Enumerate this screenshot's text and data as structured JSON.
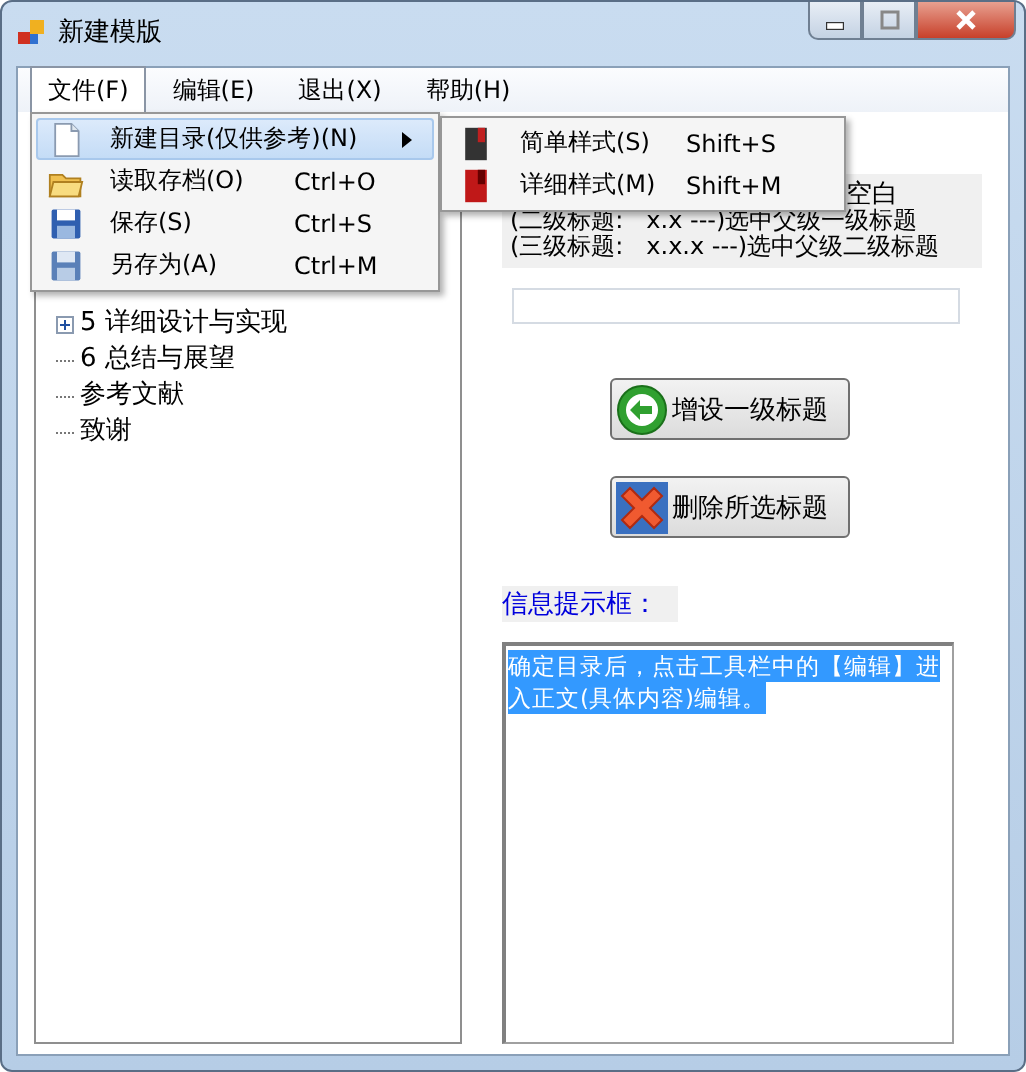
{
  "window": {
    "title": "新建模版"
  },
  "menu_bar": [
    {
      "label": "文件(F)",
      "selected": true
    },
    {
      "label": "编辑(E)",
      "selected": false
    },
    {
      "label": "退出(X)",
      "selected": false
    },
    {
      "label": "帮助(H)",
      "selected": false
    }
  ],
  "file_menu": [
    {
      "label": "新建目录(仅供参考)(N)",
      "submenu": true,
      "selected": true
    },
    {
      "label": "读取存档(O)",
      "shortcut": "Ctrl+O",
      "submenu": false,
      "selected": false
    },
    {
      "label": "保存(S)",
      "shortcut": "Ctrl+S",
      "submenu": false,
      "selected": false
    },
    {
      "label": "另存为(A)",
      "shortcut": "Ctrl+M",
      "submenu": false,
      "selected": false
    }
  ],
  "submenu": [
    {
      "label": "简单样式(S)",
      "shortcut": "Shift+S",
      "selected": false
    },
    {
      "label": "详细样式(M)",
      "shortcut": "Shift+M",
      "selected": false
    }
  ],
  "tree": [
    {
      "label": "5 详细设计与实现",
      "expandable": true
    },
    {
      "label": "6 总结与展望",
      "expandable": false
    },
    {
      "label": "参考文献",
      "expandable": false
    },
    {
      "label": "致谢",
      "expandable": false
    }
  ],
  "hint_lines": [
    "空白",
    "(二级标题:   x.x ---)选中父级一级标题",
    "(三级标题:   x.x.x ---)选中父级二级标题"
  ],
  "buttons": [
    {
      "label": "增设一级标题",
      "kind": "add"
    },
    {
      "label": "删除所选标题",
      "kind": "delete"
    }
  ],
  "info_label": "信息提示框：",
  "info_box": {
    "lines": [
      "确定目录后，点击工具栏中的【编辑】进",
      "入正文(具体内容)编辑。"
    ],
    "selected": true
  }
}
